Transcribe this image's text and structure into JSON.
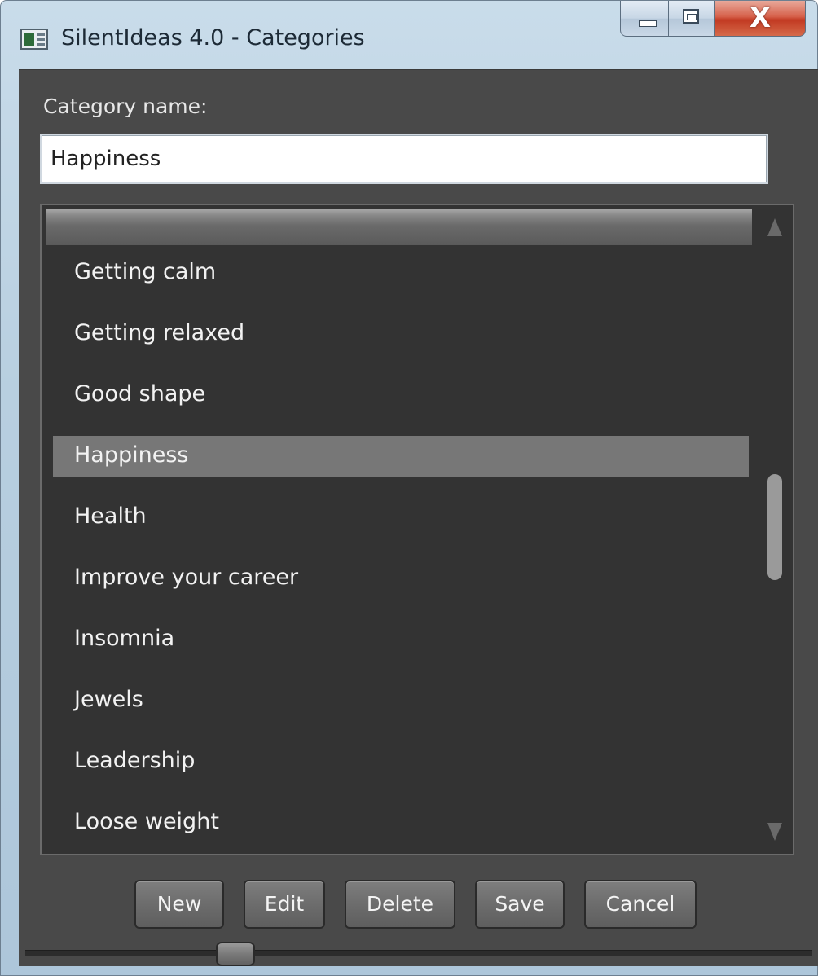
{
  "window": {
    "title": "SilentIdeas 4.0 - Categories",
    "app_icon": "app-window-icon",
    "caption_buttons": {
      "minimize": "minimize-icon",
      "maximize": "maximize-icon",
      "close_glyph": "X"
    }
  },
  "form": {
    "category_label": "Category name:",
    "category_value": "Happiness"
  },
  "list": {
    "items": [
      "Getting calm",
      "Getting relaxed",
      "Good shape",
      "Happiness",
      "Health",
      "Improve your career",
      "Insomnia",
      "Jewels",
      "Leadership",
      "Loose weight"
    ],
    "selected": "Happiness",
    "scroll_position": 0.45
  },
  "buttons": {
    "new": "New",
    "edit": "Edit",
    "delete": "Delete",
    "save": "Save",
    "cancel": "Cancel"
  },
  "colors": {
    "background": "#494949",
    "list_background": "#333333",
    "selected_row": "#777777",
    "text": "#f2f2f2",
    "close_button": "#c23a22"
  }
}
